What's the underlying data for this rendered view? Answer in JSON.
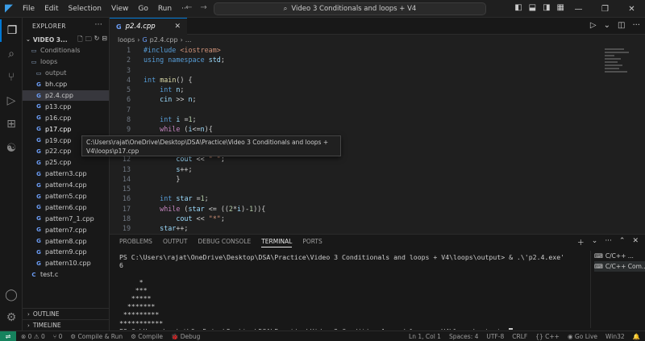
{
  "menu": [
    "File",
    "Edit",
    "Selection",
    "View",
    "Go",
    "Run",
    "···"
  ],
  "search": {
    "title": "Video 3 Conditionals and loops + V4"
  },
  "explorer": {
    "title": "EXPLORER",
    "more": "···",
    "workspace": "VIDEO 3...",
    "items": [
      {
        "label": "Conditionals",
        "type": "folder",
        "indent": 0
      },
      {
        "label": "loops",
        "type": "folder",
        "indent": 0
      },
      {
        "label": "output",
        "type": "folder",
        "indent": 1
      },
      {
        "label": "bh.cpp",
        "type": "file",
        "indent": 1
      },
      {
        "label": "p2.4.cpp",
        "type": "file",
        "indent": 1,
        "selected": true
      },
      {
        "label": "p13.cpp",
        "type": "file",
        "indent": 1
      },
      {
        "label": "p16.cpp",
        "type": "file",
        "indent": 1
      },
      {
        "label": "p17.cpp",
        "type": "file",
        "indent": 1,
        "hover": true
      },
      {
        "label": "p19.cpp",
        "type": "file",
        "indent": 1
      },
      {
        "label": "p22.cpp",
        "type": "file",
        "indent": 1
      },
      {
        "label": "p25.cpp",
        "type": "file",
        "indent": 1
      },
      {
        "label": "pattern3.cpp",
        "type": "file",
        "indent": 1
      },
      {
        "label": "pattern4.cpp",
        "type": "file",
        "indent": 1
      },
      {
        "label": "pattern5.cpp",
        "type": "file",
        "indent": 1
      },
      {
        "label": "pattern6.cpp",
        "type": "file",
        "indent": 1
      },
      {
        "label": "pattern7_1.cpp",
        "type": "file",
        "indent": 1
      },
      {
        "label": "pattern7.cpp",
        "type": "file",
        "indent": 1
      },
      {
        "label": "pattern8.cpp",
        "type": "file",
        "indent": 1
      },
      {
        "label": "pattern9.cpp",
        "type": "file",
        "indent": 1
      },
      {
        "label": "pattern10.cpp",
        "type": "file",
        "indent": 1
      },
      {
        "label": "test.c",
        "type": "file",
        "indent": 0
      }
    ],
    "outline": "OUTLINE",
    "timeline": "TIMELINE"
  },
  "tooltip": {
    "path": "C:\\Users\\rajat\\OneDrive\\Desktop\\DSA\\Practice\\Video 3 Conditionals and loops + V4\\loops\\p17.cpp"
  },
  "tab": {
    "label": "p2.4.cpp"
  },
  "breadcrumb": [
    "loops",
    "p2.4.cpp",
    "..."
  ],
  "code": [
    {
      "n": "1",
      "html": "<span class=\"pre\">#include</span> <span class=\"str\">&lt;iostream&gt;</span>"
    },
    {
      "n": "2",
      "html": "<span class=\"kw\">using namespace</span> <span class=\"var\">std</span>;"
    },
    {
      "n": "3",
      "html": ""
    },
    {
      "n": "4",
      "html": "<span class=\"kw\">int</span> <span class=\"fn\">main</span>() {"
    },
    {
      "n": "5",
      "html": "    <span class=\"kw\">int</span> <span class=\"var\">n</span>;"
    },
    {
      "n": "6",
      "html": "    <span class=\"var\">cin</span> &gt;&gt; <span class=\"var\">n</span>;"
    },
    {
      "n": "7",
      "html": ""
    },
    {
      "n": "8",
      "html": "    <span class=\"kw\">int</span> <span class=\"var\">i</span> =<span class=\"num\">1</span>;"
    },
    {
      "n": "9",
      "html": "    <span class=\"ctl\">while</span> (<span class=\"var\">i</span>&lt;=<span class=\"var\">n</span>){"
    },
    {
      "n": "10",
      "html": ""
    },
    {
      "n": "11",
      "html": ""
    },
    {
      "n": "12",
      "html": "        <span class=\"var\">cout</span> &lt;&lt; <span class=\"str\">\" \"</span>;"
    },
    {
      "n": "13",
      "html": "        <span class=\"var\">s</span>++;"
    },
    {
      "n": "14",
      "html": "        }"
    },
    {
      "n": "15",
      "html": ""
    },
    {
      "n": "16",
      "html": "    <span class=\"kw\">int</span> <span class=\"var\">star</span> =<span class=\"num\">1</span>;"
    },
    {
      "n": "17",
      "html": "    <span class=\"ctl\">while</span> (<span class=\"var\">star</span> &lt;= ((<span class=\"num\">2</span>*<span class=\"var\">i</span>)-<span class=\"num\">1</span>)){"
    },
    {
      "n": "18",
      "html": "        <span class=\"var\">cout</span> &lt;&lt; <span class=\"str\">\"*\"</span>;"
    },
    {
      "n": "19",
      "html": "    <span class=\"var\">star</span>++;"
    }
  ],
  "panel": {
    "tabs": [
      "PROBLEMS",
      "OUTPUT",
      "DEBUG CONSOLE",
      "TERMINAL",
      "PORTS"
    ],
    "active_tab": "TERMINAL",
    "terminal_lines": [
      "PS C:\\Users\\rajat\\OneDrive\\Desktop\\DSA\\Practice\\Video 3 Conditionals and loops + V4\\loops\\output> & .\\'p2.4.exe'",
      "6",
      "",
      "     *",
      "    ***",
      "   *****",
      "  *******",
      " *********",
      "***********",
      "PS C:\\Users\\rajat\\OneDrive\\Desktop\\DSA\\Practice\\Video 3 Conditionals and loops + V4\\loops\\output> "
    ],
    "terminals": [
      "C/C++ ...",
      "C/C++ Com..."
    ]
  },
  "status": {
    "errors": "0",
    "warnings": "0",
    "ports": "0",
    "compile_run": "Compile & Run",
    "compile": "Compile",
    "debug": "Debug",
    "position": "Ln 1, Col 1",
    "spaces": "Spaces: 4",
    "encoding": "UTF-8",
    "eol": "CRLF",
    "language": "C++",
    "golive": "Go Live",
    "platform": "Win32"
  }
}
